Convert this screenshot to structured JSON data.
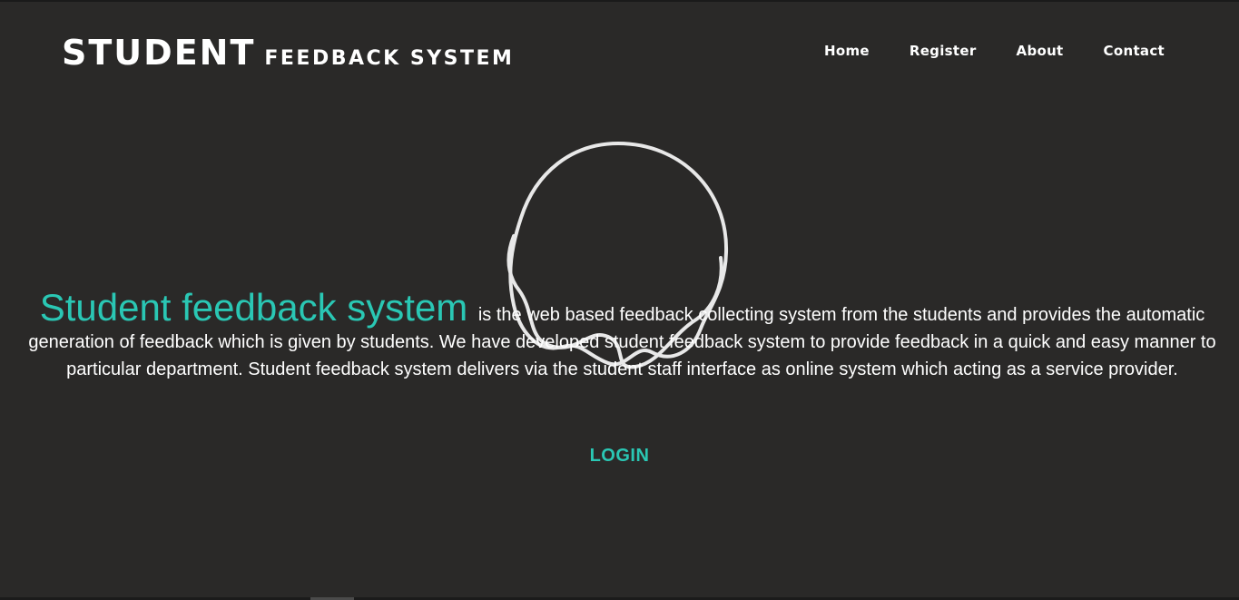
{
  "brand": {
    "main": "STUDENT",
    "sub": "FEEDBACK SYSTEM"
  },
  "nav": {
    "items": [
      {
        "label": "Home"
      },
      {
        "label": "Register"
      },
      {
        "label": "About"
      },
      {
        "label": "Contact"
      }
    ]
  },
  "hero": {
    "title": "Student feedback system",
    "body": "is the web based feedback collecting system from the students and provides the automatic generation of feedback which is given by students. We have developed student feedback system to provide feedback in a quick and easy manner to particular department. Student feedback system delivers via the student staff interface as online system which acting as a service provider.",
    "login_label": "LOGIN"
  },
  "colors": {
    "background": "#2a2928",
    "accent": "#2ac7b4",
    "text": "#ffffff"
  }
}
